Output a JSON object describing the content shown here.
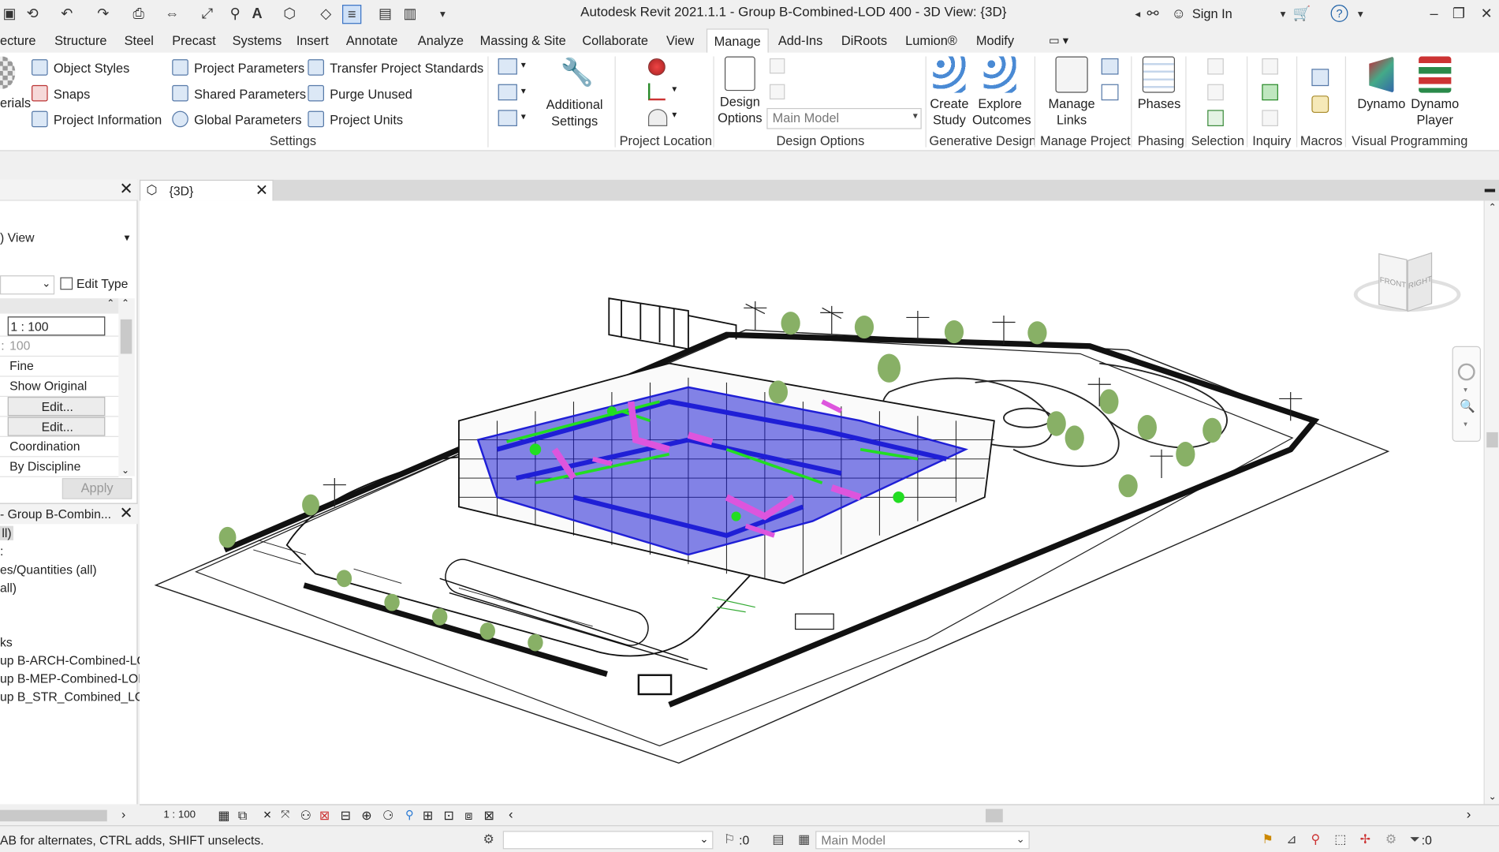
{
  "window": {
    "title": "Autodesk Revit 2021.1.1 - Group B-Combined-LOD 400 - 3D View: {3D}",
    "sign_in": "Sign In"
  },
  "tabs": [
    "ecture",
    "Structure",
    "Steel",
    "Precast",
    "Systems",
    "Insert",
    "Annotate",
    "Analyze",
    "Massing & Site",
    "Collaborate",
    "View",
    "Manage",
    "Add-Ins",
    "DiRoots",
    "Lumion®",
    "Modify"
  ],
  "active_tab": "Manage",
  "ribbon": {
    "settings": {
      "materials": "erials",
      "object_styles": "Object Styles",
      "snaps": "Snaps",
      "project_information": "Project Information",
      "project_parameters": "Project Parameters",
      "shared_parameters": "Shared Parameters",
      "global_parameters": "Global Parameters",
      "transfer_project_standards": "Transfer Project Standards",
      "purge_unused": "Purge Unused",
      "project_units": "Project Units",
      "additional_settings": "Additional Settings",
      "panel": "Settings"
    },
    "project_location": {
      "panel": "Project Location"
    },
    "design_options": {
      "button": "Design Options",
      "current": "Main Model",
      "panel": "Design Options"
    },
    "generative_design": {
      "create_study": "Create Study",
      "explore_outcomes": "Explore Outcomes",
      "panel": "Generative Design"
    },
    "manage_project": {
      "manage_links": "Manage Links",
      "panel": "Manage Project"
    },
    "phasing": {
      "phases": "Phases",
      "panel": "Phasing"
    },
    "selection": {
      "panel": "Selection"
    },
    "inquiry": {
      "panel": "Inquiry"
    },
    "macros": {
      "panel": "Macros"
    },
    "visual_programming": {
      "dynamo": "Dynamo",
      "dynamo_player": "Dynamo Player",
      "panel": "Visual Programming"
    }
  },
  "properties": {
    "type_selector": "View",
    "edit_type": "Edit Type",
    "rows": [
      {
        "value": "1 : 100"
      },
      {
        "value": "100"
      },
      {
        "value": "Fine"
      },
      {
        "value": "Show Original"
      },
      {
        "value": "Edit..."
      },
      {
        "value": "Edit..."
      },
      {
        "value": "Coordination"
      },
      {
        "value": "By Discipline"
      }
    ],
    "apply": "Apply"
  },
  "project_browser": {
    "title": "- Group B-Combin...",
    "items": [
      "ll)",
      ":",
      "es/Quantities (all)",
      "all)",
      "",
      "ks",
      "up B-ARCH-Combined-LC",
      "up B-MEP-Combined-LOI",
      "up B_STR_Combined_LOD"
    ]
  },
  "view_tab": {
    "label": "{3D}"
  },
  "viewcube": {
    "front": "FRONT",
    "right": "RIGHT"
  },
  "view_control_bar": {
    "scale": "1 : 100"
  },
  "status_bar": {
    "message": "AB for alternates, CTRL adds, SHIFT unselects.",
    "worksharing_count": ":0",
    "design_option": "Main Model",
    "filter_count": ":0"
  },
  "colors": {
    "accent": "#1b5fa6",
    "mep_blue": "#1f1fd6",
    "mep_green": "#22dd22",
    "mep_magenta": "#dd55dd"
  }
}
